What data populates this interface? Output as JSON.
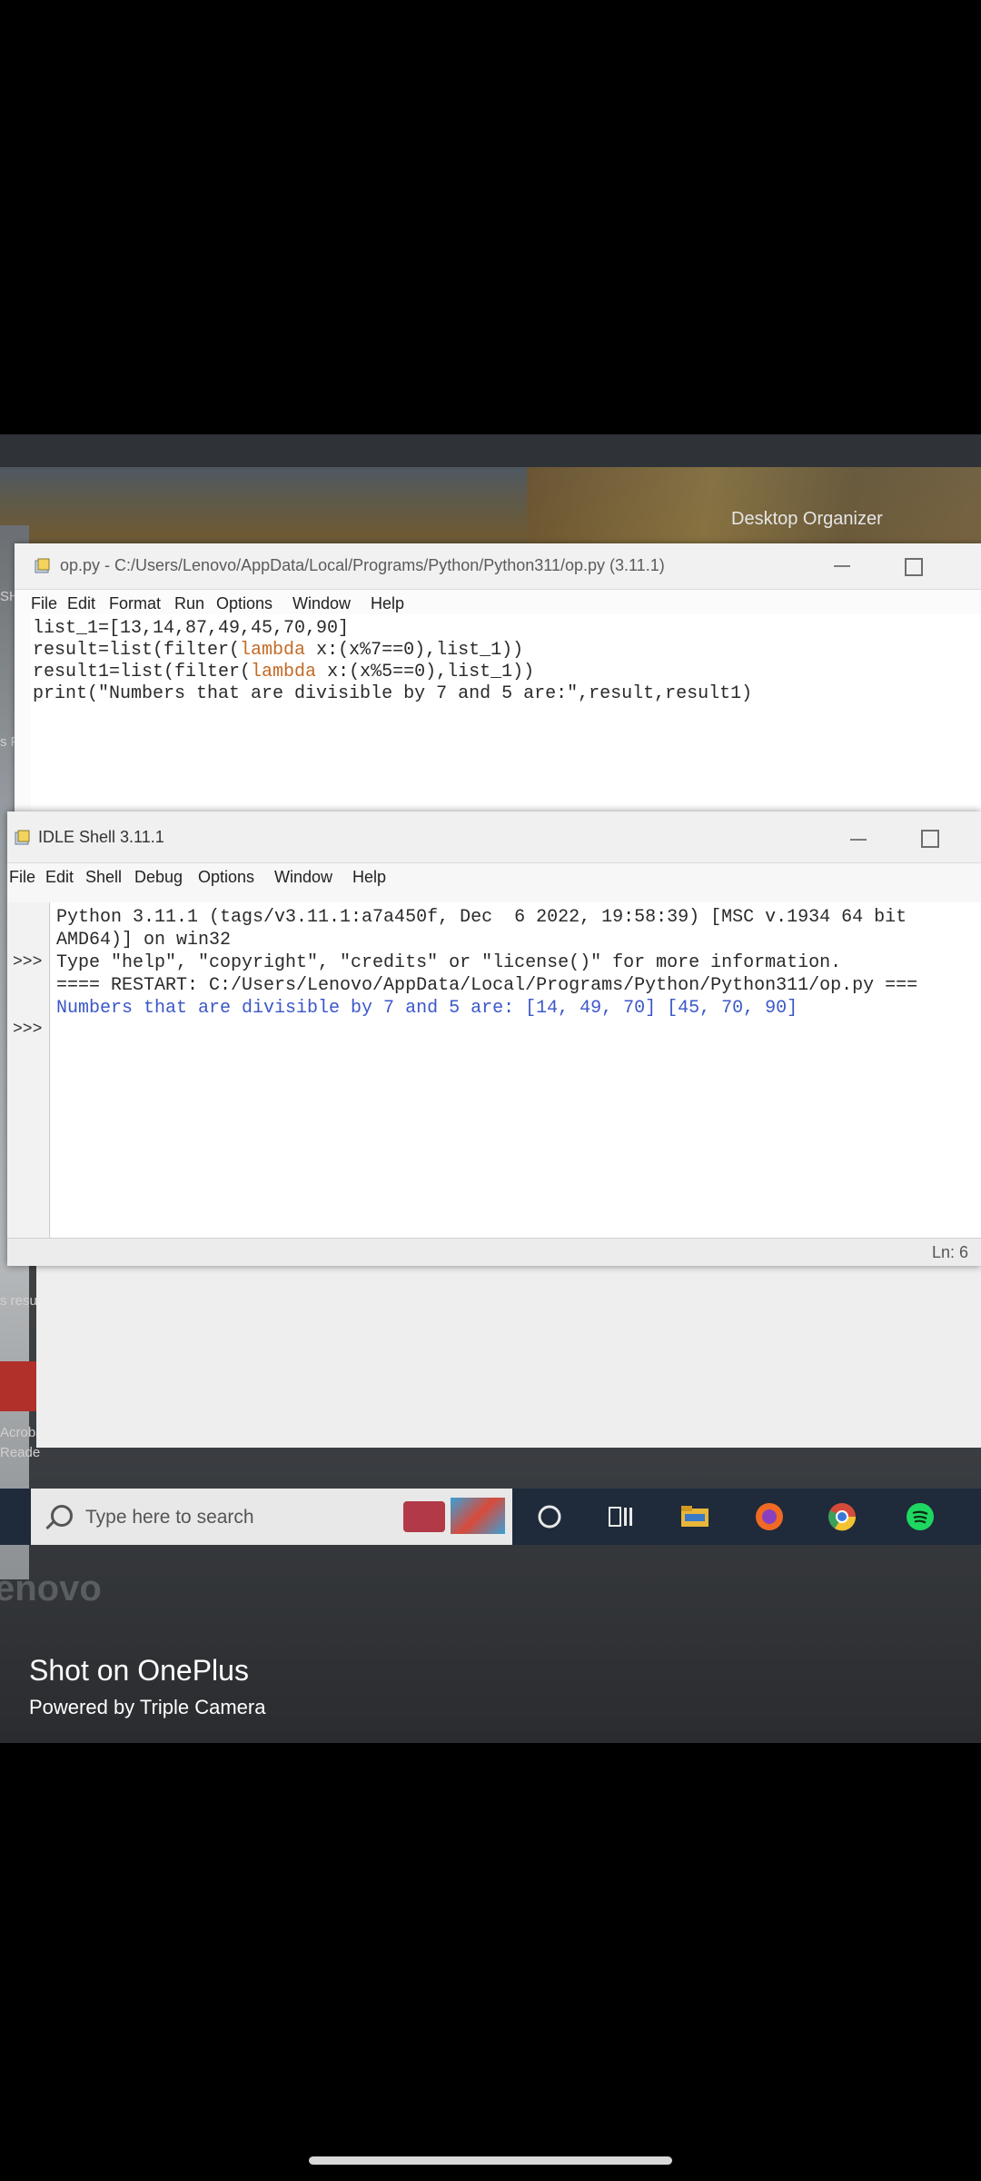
{
  "desktop": {
    "organizer_label": "Desktop Organizer",
    "side_labels": [
      "SHI",
      "s Pc",
      "s resu",
      "Acroba",
      "Reade"
    ]
  },
  "editor": {
    "title": "op.py - C:/Users/Lenovo/AppData/Local/Programs/Python/Python311/op.py (3.11.1)",
    "menu": [
      "File",
      "Edit",
      "Format",
      "Run",
      "Options",
      "Window",
      "Help"
    ],
    "code_lines": [
      {
        "pre": "list_1=[13,14,87,49,45,70,90]",
        "kw": "",
        "post": ""
      },
      {
        "pre": "result=list(filter(",
        "kw": "lambda",
        "post": " x:(x%7==0),list_1))"
      },
      {
        "pre": "result1=list(filter(",
        "kw": "lambda",
        "post": " x:(x%5==0),list_1))"
      },
      {
        "pre": "print(\"Numbers that are divisible by 7 and 5 are:\",result,result1)",
        "kw": "",
        "post": ""
      }
    ]
  },
  "shell": {
    "title": "IDLE Shell 3.11.1",
    "menu": [
      "File",
      "Edit",
      "Shell",
      "Debug",
      "Options",
      "Window",
      "Help"
    ],
    "prompts": [
      ">>>",
      ">>>"
    ],
    "lines": [
      "Python 3.11.1 (tags/v3.11.1:a7a450f, Dec  6 2022, 19:58:39) [MSC v.1934 64 bit",
      "AMD64)] on win32",
      "Type \"help\", \"copyright\", \"credits\" or \"license()\" for more information.",
      "",
      "==== RESTART: C:/Users/Lenovo/AppData/Local/Programs/Python/Python311/op.py ==="
    ],
    "output_line": "Numbers that are divisible by 7 and 5 are: [14, 49, 70] [45, 70, 90]",
    "status": "Ln: 6"
  },
  "taskbar": {
    "search_placeholder": "Type here to search"
  },
  "brand": "enovo",
  "watermark": {
    "line1": "Shot on OnePlus",
    "line2": "Powered by Triple Camera"
  }
}
